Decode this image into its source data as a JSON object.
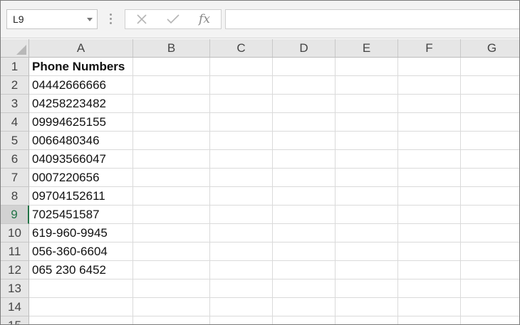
{
  "name_box": {
    "value": "L9"
  },
  "formula_bar": {
    "cancel_icon": "x-icon",
    "enter_icon": "check-icon",
    "fx_label": "fx",
    "formula_value": ""
  },
  "grid": {
    "columns": [
      "A",
      "B",
      "C",
      "D",
      "E",
      "F",
      "G"
    ],
    "rows": [
      "1",
      "2",
      "3",
      "4",
      "5",
      "6",
      "7",
      "8",
      "9",
      "10",
      "11",
      "12",
      "13",
      "14",
      "15"
    ],
    "active_row": "9",
    "column_a": [
      "Phone Numbers",
      "04442666666",
      "04258223482",
      "09994625155",
      "0066480346",
      "04093566047",
      "0007220656",
      "09704152611",
      "7025451587",
      "619-960-9945",
      "056-360-6604",
      "065 230 6452",
      "",
      "",
      ""
    ]
  },
  "colors": {
    "accent_green": "#217346",
    "header_bg": "#e6e6e6",
    "gridline": "#dadada"
  }
}
